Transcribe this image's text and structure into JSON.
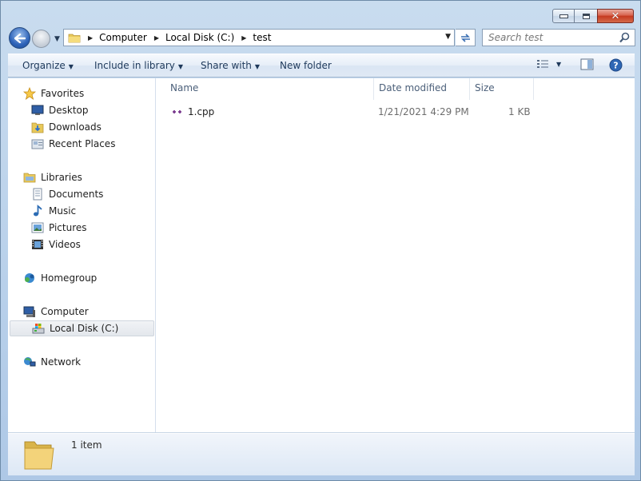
{
  "address": {
    "crumbs": [
      "Computer",
      "Local Disk (C:)",
      "test"
    ]
  },
  "search": {
    "placeholder": "Search test"
  },
  "toolbar": {
    "organize": "Organize",
    "include_in_library": "Include in library",
    "share_with": "Share with",
    "new_folder": "New folder"
  },
  "sidebar": {
    "favorites": "Favorites",
    "desktop": "Desktop",
    "downloads": "Downloads",
    "recent_places": "Recent Places",
    "libraries": "Libraries",
    "documents": "Documents",
    "music": "Music",
    "pictures": "Pictures",
    "videos": "Videos",
    "homegroup": "Homegroup",
    "computer": "Computer",
    "local_disk": "Local Disk (C:)",
    "network": "Network"
  },
  "columns": {
    "name": "Name",
    "date_modified": "Date modified",
    "size": "Size"
  },
  "files": [
    {
      "name": "1.cpp",
      "date_modified": "1/21/2021 4:29 PM",
      "size": "1 KB"
    }
  ],
  "details": {
    "item_count": "1 item"
  },
  "colors": {
    "accent": "#1e395b",
    "selection": "#e3e7ec"
  }
}
